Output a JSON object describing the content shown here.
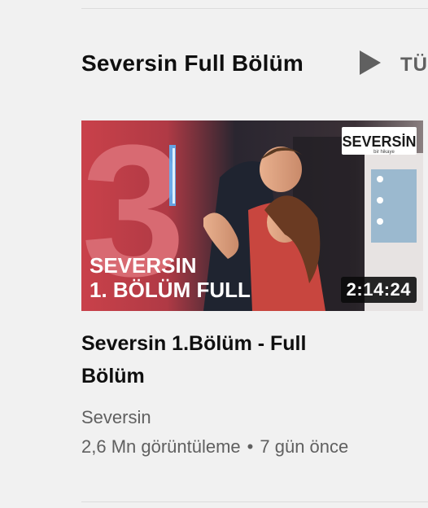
{
  "shelf": {
    "title": "Seversin Full Bölüm",
    "play_all_label": "TÜ"
  },
  "video": {
    "title": "Seversin 1.Bölüm - Full Bölüm",
    "duration": "2:14:24",
    "channel": "Seversin",
    "views": "2,6 Mn görüntüleme",
    "separator": "•",
    "age": "7 gün önce",
    "thumbnail": {
      "overlay_line1": "SEVERSIN",
      "overlay_line2": "1. BÖLÜM FULL",
      "episode_number": "3",
      "logo_text": "SEVERSİN",
      "logo_subtext": "bir hikaye"
    }
  }
}
